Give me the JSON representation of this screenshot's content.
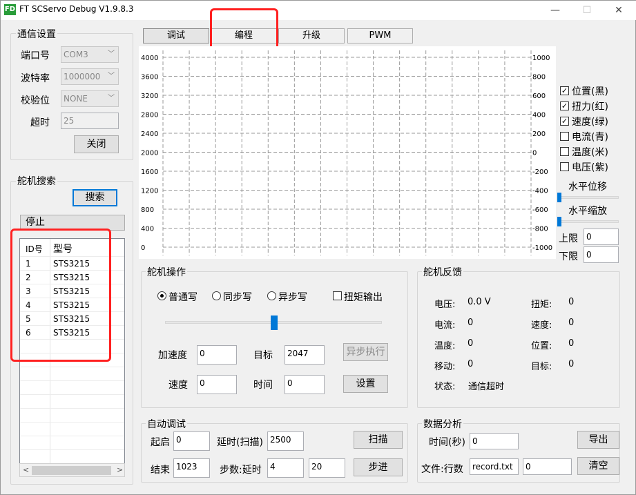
{
  "window": {
    "logo": "FD",
    "title": "FT SCServo Debug V1.9.8.3",
    "controls": [
      "—",
      "☐",
      "✕"
    ]
  },
  "tabs": [
    "调试",
    "编程",
    "升级",
    "PWM"
  ],
  "comm": {
    "title": "通信设置",
    "port_label": "端口号",
    "port_value": "COM3",
    "baud_label": "波特率",
    "baud_value": "1000000",
    "parity_label": "校验位",
    "parity_value": "NONE",
    "timeout_label": "超时",
    "timeout_value": "25",
    "close_btn": "关闭"
  },
  "search": {
    "title": "舵机搜索",
    "search_btn": "搜索",
    "stop_btn": "停止",
    "headers": [
      "ID号",
      "型号"
    ],
    "rows": [
      [
        "1",
        "STS3215"
      ],
      [
        "2",
        "STS3215"
      ],
      [
        "3",
        "STS3215"
      ],
      [
        "4",
        "STS3215"
      ],
      [
        "5",
        "STS3215"
      ],
      [
        "6",
        "STS3215"
      ]
    ],
    "scroll_left": "<",
    "scroll_right": ">"
  },
  "chart_data": {
    "type": "line",
    "y_left_ticks": [
      "4000",
      "3600",
      "3200",
      "2800",
      "2400",
      "2000",
      "1600",
      "1200",
      "800",
      "400",
      "0"
    ],
    "y_right_ticks": [
      "1000",
      "800",
      "600",
      "400",
      "200",
      "0",
      "-200",
      "-400",
      "-600",
      "-800",
      "-1000"
    ],
    "ylim_left": [
      0,
      4000
    ],
    "ylim_right": [
      -1000,
      1000
    ],
    "grid": true,
    "series": []
  },
  "legend": {
    "items": [
      {
        "label": "位置(黑)",
        "checked": true
      },
      {
        "label": "扭力(红)",
        "checked": true
      },
      {
        "label": "速度(绿)",
        "checked": true
      },
      {
        "label": "电流(青)",
        "checked": false
      },
      {
        "label": "温度(米)",
        "checked": false
      },
      {
        "label": "电压(紫)",
        "checked": false
      }
    ],
    "hshift": "水平位移",
    "hscale": "水平缩放",
    "upper_label": "上限",
    "upper_value": "0",
    "lower_label": "下限",
    "lower_value": "0"
  },
  "op": {
    "title": "舵机操作",
    "radios": [
      {
        "label": "普通写",
        "on": true
      },
      {
        "label": "同步写",
        "on": false
      },
      {
        "label": "异步写",
        "on": false
      }
    ],
    "torque_label": "扭矩输出",
    "slider_level": 0.5,
    "acc_label": "加速度",
    "acc_value": "0",
    "target_label": "目标",
    "target_value": "2047",
    "async_btn": "异步执行",
    "speed_label": "速度",
    "speed_value": "0",
    "time_label": "时间",
    "time_value": "0",
    "set_btn": "设置"
  },
  "fb": {
    "title": "舵机反馈",
    "voltage_label": "电压:",
    "voltage": "0.0 V",
    "torque_label": "扭矩:",
    "torque": "0",
    "current_label": "电流:",
    "current": "0",
    "speed_label": "速度:",
    "speed": "0",
    "temp_label": "温度:",
    "temp": "0",
    "pos_label": "位置:",
    "pos": "0",
    "move_label": "移动:",
    "move": "0",
    "target_label": "目标:",
    "target": "0",
    "status_label": "状态:",
    "status": "通信超时"
  },
  "auto": {
    "title": "自动调试",
    "start_label": "起启",
    "start_value": "0",
    "delay_label": "延时(扫描)",
    "delay_value": "2500",
    "scan_btn": "扫描",
    "end_label": "结束",
    "end_value": "1023",
    "step_label": "步数:延时",
    "step_value": "4",
    "step_delay": "20",
    "step_btn": "步进"
  },
  "data": {
    "title": "数据分析",
    "time_label": "时间(秒)",
    "time_value": "0",
    "export_btn": "导出",
    "file_label": "文件:行数",
    "file_value": "record.txt",
    "rows_value": "0",
    "clear_btn": "清空"
  }
}
